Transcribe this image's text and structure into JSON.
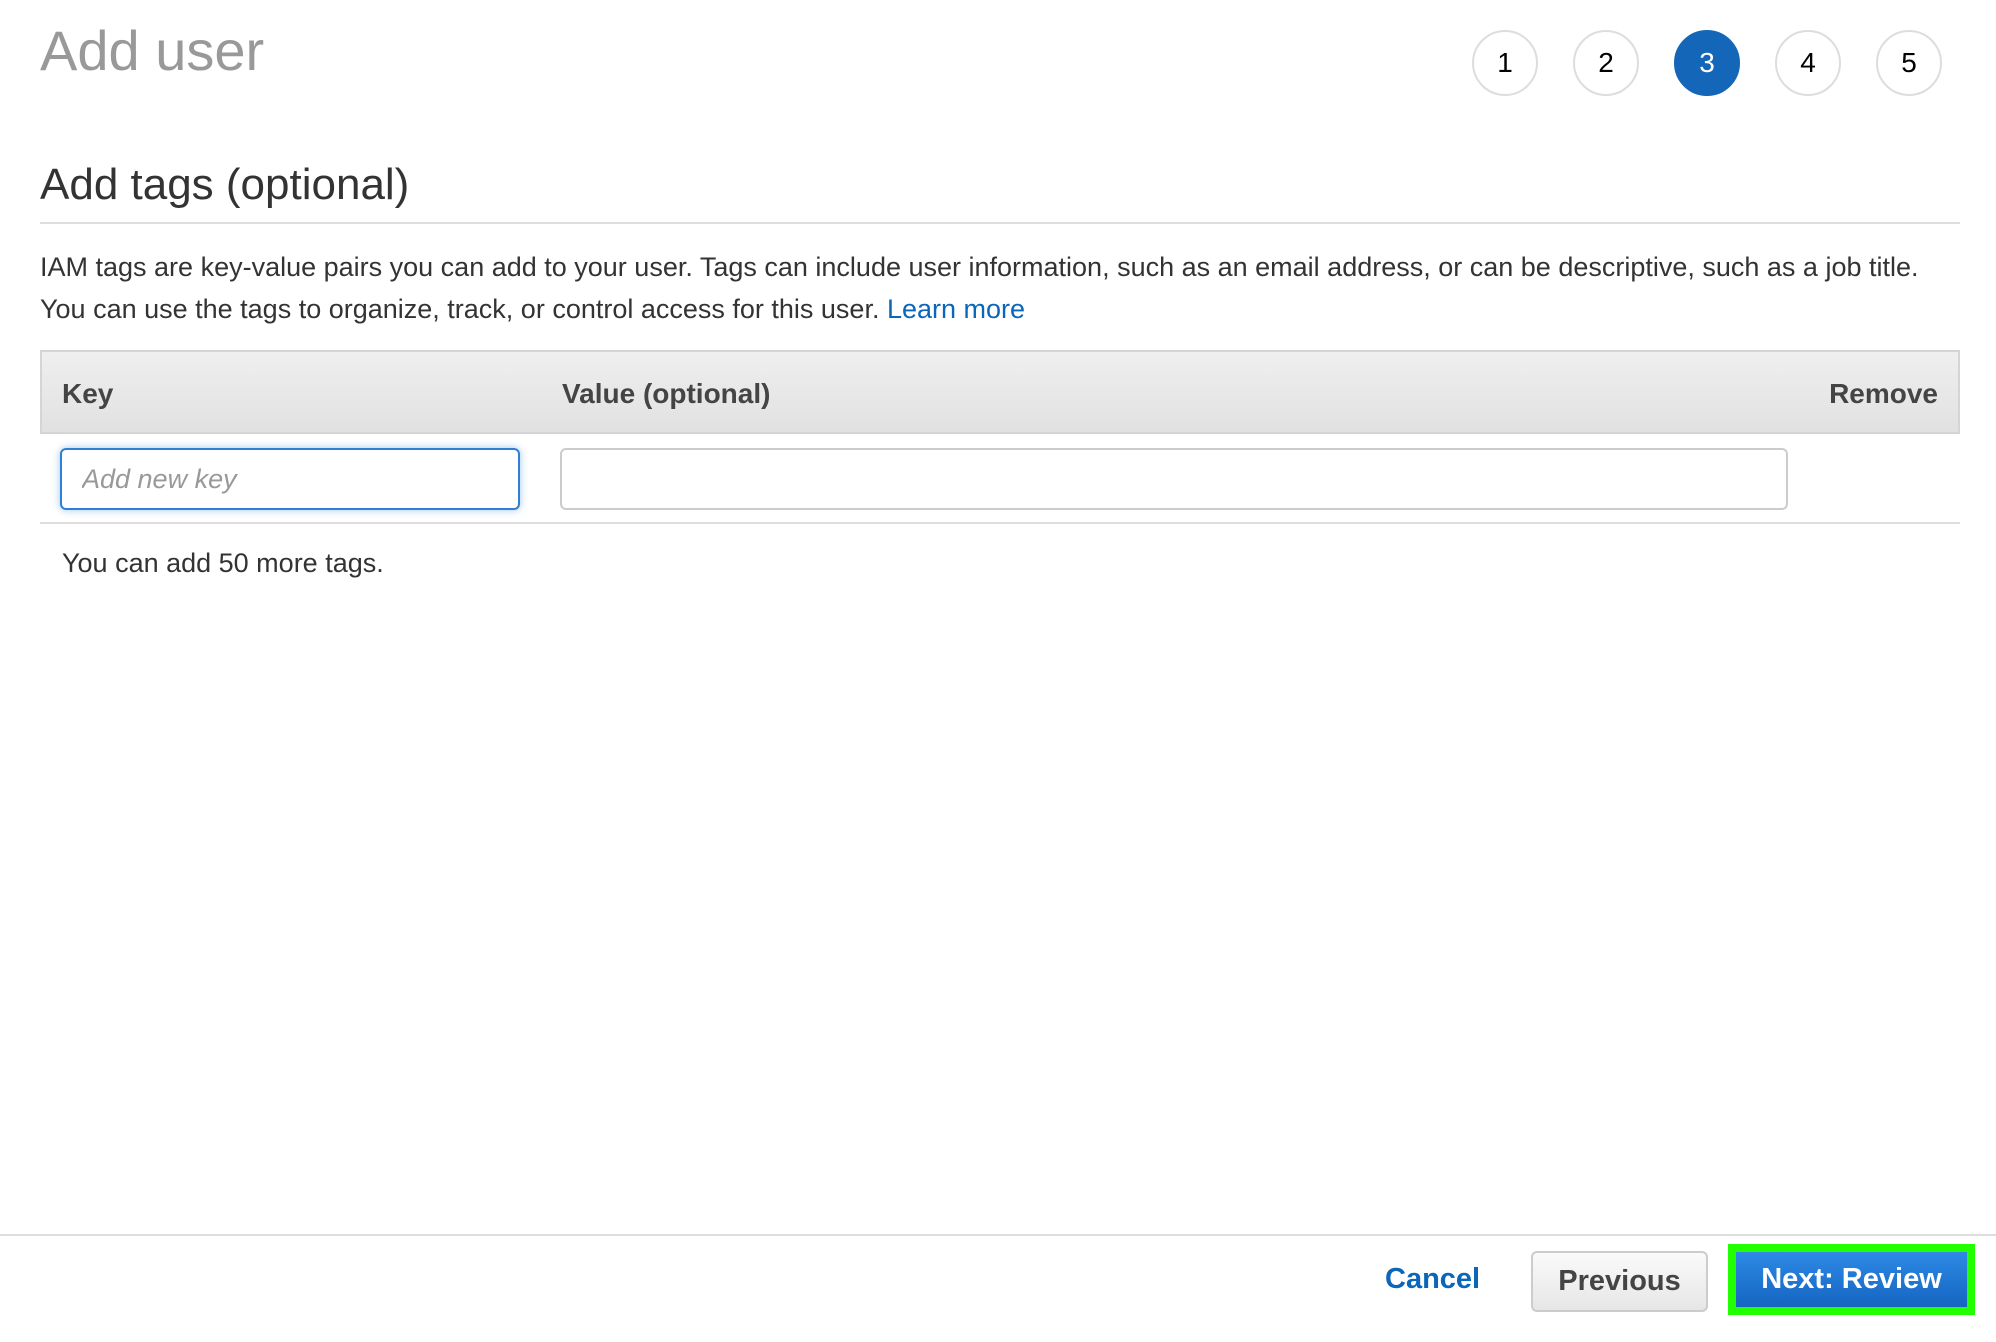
{
  "header": {
    "title": "Add user"
  },
  "wizard": {
    "steps": [
      "1",
      "2",
      "3",
      "4",
      "5"
    ],
    "current_step": 3,
    "accent": "#1466b8"
  },
  "section": {
    "title": "Add tags (optional)",
    "description": "IAM tags are key-value pairs you can add to your user. Tags can include user information, such as an email address, or can be descriptive, such as a job title. You can use the tags to organize, track, or control access for this user. ",
    "learn_more": "Learn more"
  },
  "table": {
    "headers": {
      "key": "Key",
      "value": "Value (optional)",
      "remove": "Remove"
    },
    "row": {
      "key_value": "",
      "key_placeholder": "Add new key",
      "value_value": ""
    }
  },
  "tag_count_text": "You can add 50 more tags.",
  "footer": {
    "cancel": "Cancel",
    "previous": "Previous",
    "next": "Next: Review",
    "highlight": "#22ff00"
  }
}
